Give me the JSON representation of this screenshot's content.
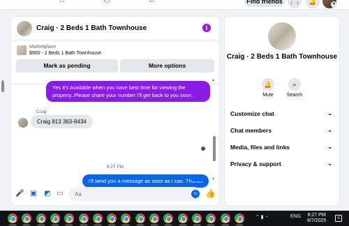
{
  "top_nav": {
    "find_friends_label": "Find friends",
    "icons": [
      "home-icon",
      "profile-icon",
      "groups-icon",
      "menu-grid-icon",
      "notifications-icon",
      "account-avatar"
    ]
  },
  "chat": {
    "title": "Craig · 2 Beds 1 Bath Townhouse",
    "marketplace": {
      "label": "Marketplace",
      "listing": "$900 - 2 Beds 1 Bath Townhouse",
      "mark_pending_label": "Mark as pending",
      "more_options_label": "More options"
    },
    "messages": {
      "outgoing_1": "Yes it's Available when you have best time for viewing the property..Please share your number I'll get back to you soon.",
      "sender_name": "Craig",
      "incoming_1": "Craig 813 363-8434",
      "timestamp": "8:27 PM",
      "outgoing_2": "I'll send you a message as soon as I can. Thanks"
    },
    "composer": {
      "placeholder": "Aa"
    },
    "colors": {
      "purple_bubble": "#8a1ce8",
      "blue_bubble": "#0a66e8"
    }
  },
  "info_panel": {
    "title": "Craig · 2 Beds 1 Bath Townhouse",
    "actions": [
      {
        "label": "Mute",
        "icon": "bell-icon"
      },
      {
        "label": "Search",
        "icon": "search-icon"
      }
    ],
    "sections": [
      {
        "label": "Customize chat"
      },
      {
        "label": "Chat members"
      },
      {
        "label": "Media, files and links"
      },
      {
        "label": "Privacy & support"
      }
    ]
  },
  "taskbar": {
    "language": "ENG",
    "time": "8:27 PM",
    "date": "8/7/2025",
    "app_count": 17
  }
}
